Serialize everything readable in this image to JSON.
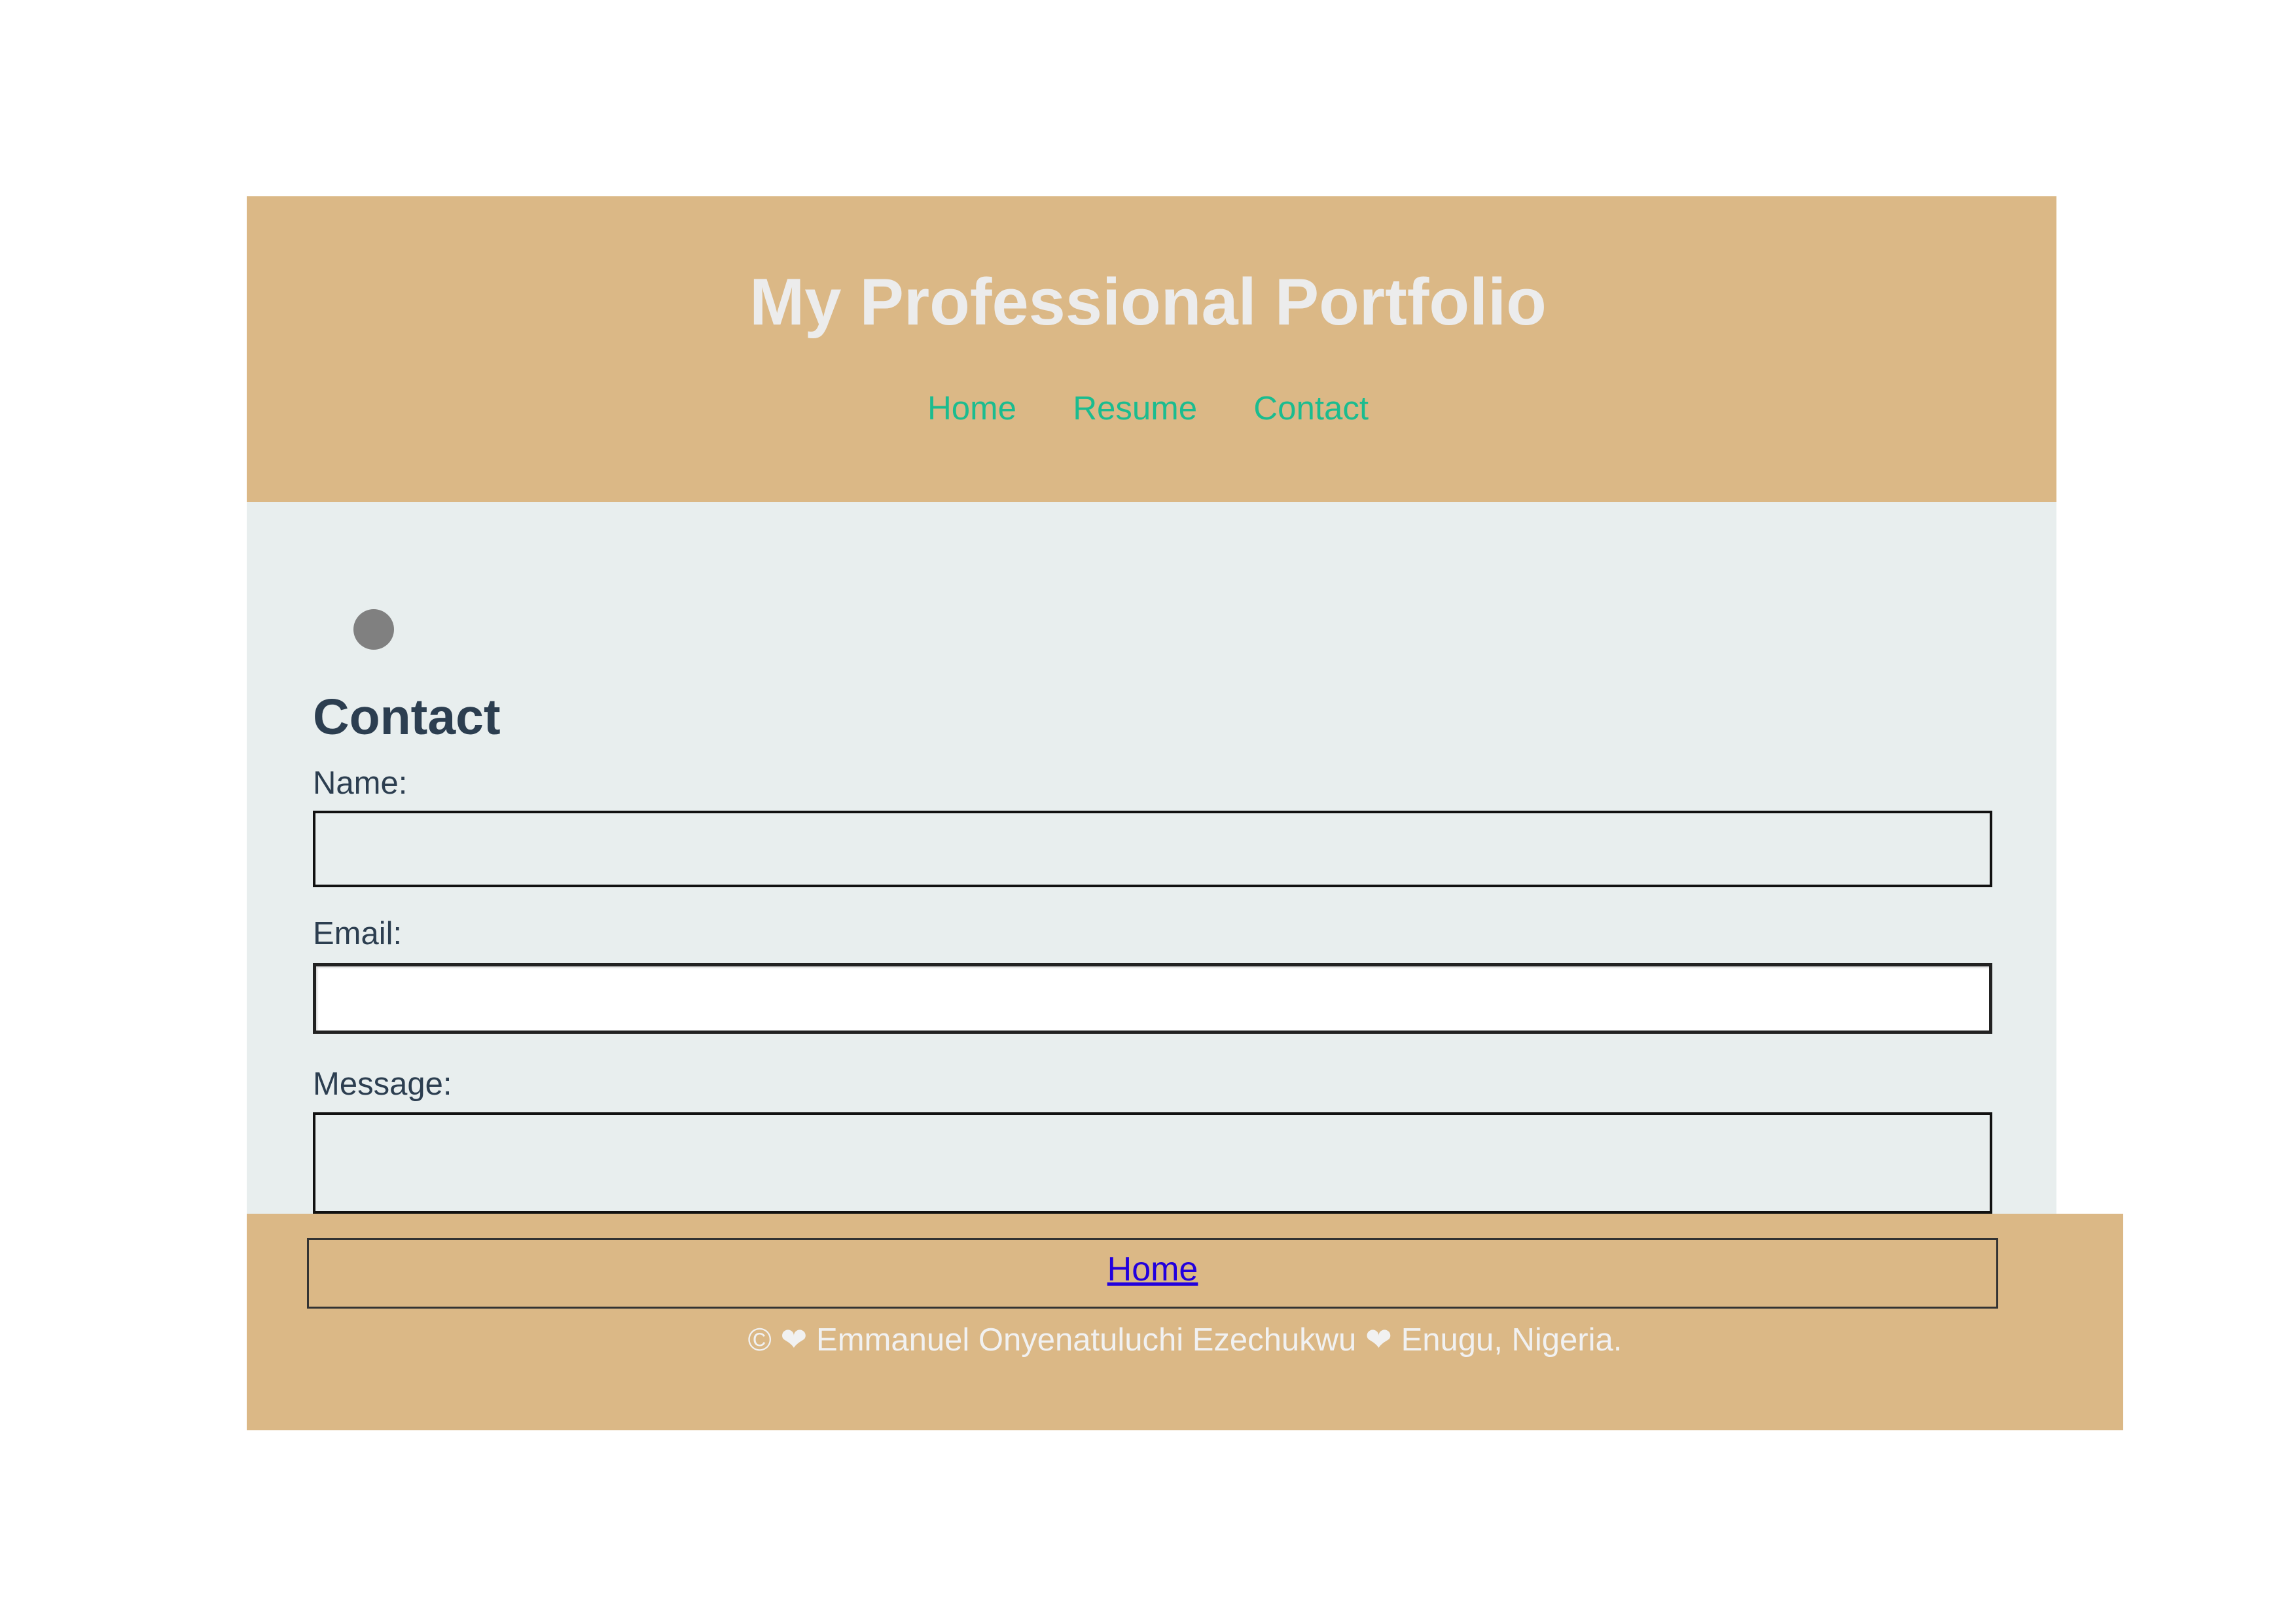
{
  "header": {
    "title": "My Professional Portfolio",
    "nav": [
      {
        "label": "Home"
      },
      {
        "label": "Resume"
      },
      {
        "label": "Contact"
      }
    ]
  },
  "main": {
    "section_title": "Contact",
    "form": {
      "name_label": "Name:",
      "name_value": "",
      "email_label": "Email:",
      "email_value": "",
      "message_label": "Message:",
      "message_value": ""
    }
  },
  "footer": {
    "nav_label": "Home",
    "copyright": "© ❤ Emmanuel Onyenatuluchi Ezechukwu ❤ Enugu, Nigeria."
  },
  "colors": {
    "header_bg": "#dbb886",
    "main_bg": "#e8eeee",
    "title_text": "#ececec",
    "nav_link": "#1bbc8f",
    "heading_text": "#2c3e50",
    "footer_link": "#2200dd"
  },
  "icons": {
    "avatar": "avatar-placeholder-circle"
  }
}
